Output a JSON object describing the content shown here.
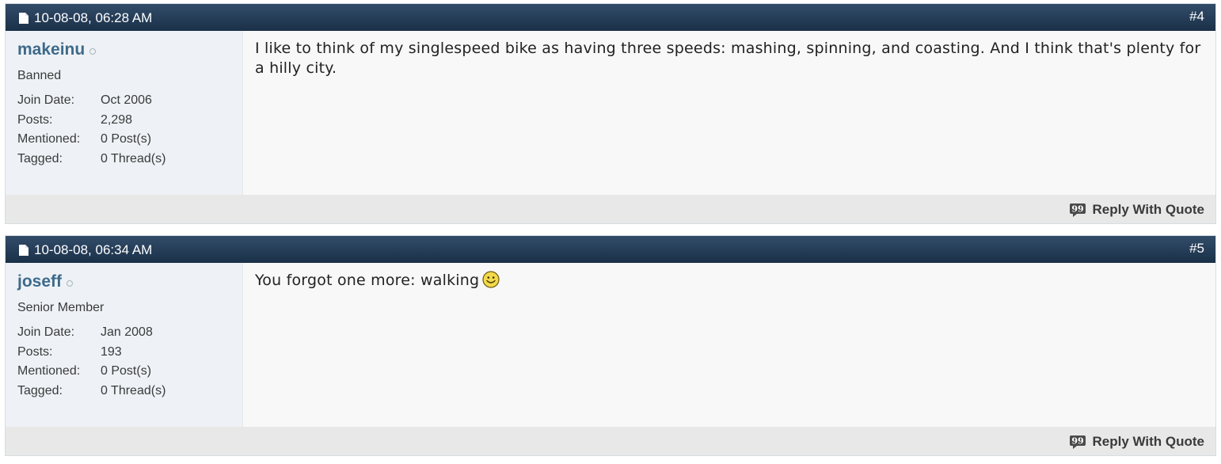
{
  "posts": [
    {
      "date": "10-08-08, 06:28 AM",
      "number": "#4",
      "username": "makeinu",
      "user_title": "Banned",
      "stats": [
        {
          "label": "Join Date:",
          "value": "Oct 2006"
        },
        {
          "label": "Posts:",
          "value": "2,298"
        },
        {
          "label": "Mentioned:",
          "value": "0 Post(s)"
        },
        {
          "label": "Tagged:",
          "value": "0 Thread(s)"
        }
      ],
      "message": "I like to think of my singlespeed bike as having three speeds: mashing, spinning, and coasting. And I think that's plenty for a hilly city.",
      "reply_label": "Reply With Quote"
    },
    {
      "date": "10-08-08, 06:34 AM",
      "number": "#5",
      "username": "joseff",
      "user_title": "Senior Member",
      "stats": [
        {
          "label": "Join Date:",
          "value": "Jan 2008"
        },
        {
          "label": "Posts:",
          "value": "193"
        },
        {
          "label": "Mentioned:",
          "value": "0 Post(s)"
        },
        {
          "label": "Tagged:",
          "value": "0 Thread(s)"
        }
      ],
      "message": "You forgot one more: walking",
      "has_smiley": true,
      "reply_label": "Reply With Quote"
    }
  ],
  "colors": {
    "header_bg": "#1f3650",
    "username": "#3e6a8a",
    "userinfo_bg": "#eef2f6",
    "footer_bg": "#e8e8e8"
  },
  "icons": {
    "date": "document-icon",
    "status": "offline-status-icon",
    "reply": "quote-bubble-icon",
    "smiley": "smiley-icon"
  }
}
